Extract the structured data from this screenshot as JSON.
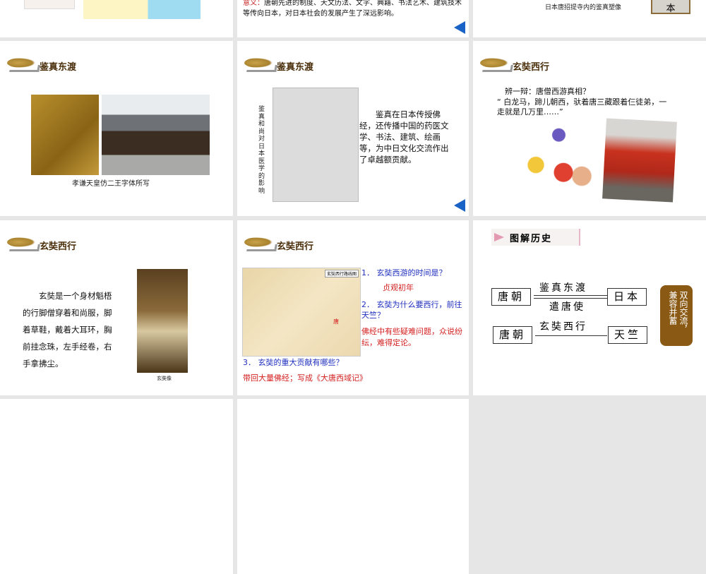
{
  "slides": {
    "s1": {},
    "s2": {
      "meaning_label": "意义：",
      "meaning_text": "唐朝先进的制度、天文历法、文字、典籍、书法艺术、建筑技术等传向日本，对日本社会的发展产生了深远影响。"
    },
    "s3": {
      "caption": "日本唐招提寺内的鉴真塑像",
      "box_text": "本"
    },
    "s4": {
      "title": "鉴真东渡",
      "caption": "孝谦天皇仿二王字体所写"
    },
    "s5": {
      "title": "鉴真东渡",
      "vertical_caption": "鉴真和尚对日本医学的影响",
      "body": "鉴真在日本传授佛经，还传播中国的药医文学、书法、建筑、绘画等，为中日文化交流作出了卓越额贡献。"
    },
    "s6": {
      "title": "玄奘西行",
      "prompt": "辨一辩：唐僧西游真相？",
      "quote": "“ 白龙马，蹄儿朝西，驮着唐三藏跟着仨徒弟，一走就是几万里……”"
    },
    "s7": {
      "title": "玄奘西行",
      "body": "玄奘是一个身材魁梧的行脚僧穿着和尚服，脚着草鞋，戴着大耳环，胸前挂念珠，左手经卷，右手拿拂尘。",
      "caption": "玄奘像"
    },
    "s8": {
      "title": "玄奘西行",
      "map_title": "玄奘西行路线图",
      "map_label_tang": "唐",
      "q1": "1． 玄奘西游的时间是？",
      "a1": "贞观初年",
      "q2": "2． 玄奘为什么要西行，前往天竺？",
      "a2": "佛经中有些疑难问题，众说纷纭，难得定论。",
      "q3": "3． 玄奘的重大贡献有哪些？",
      "a3": "带回大量佛经；写成《大唐西域记》"
    },
    "s9": {
      "title": "图解历史",
      "tang1": "唐朝",
      "japan": "日本",
      "arrow_top": "鉴真东渡",
      "arrow_bottom": "遣唐使",
      "tang2": "唐朝",
      "india": "天竺",
      "arrow2": "玄奘西行",
      "summary": "双向交流，兼容并蓄"
    }
  },
  "colors": {
    "nav_arrow": "#1a63c6",
    "question": "#1f2fbf",
    "answer": "#d42020",
    "summary_bg": "#8a5a14"
  }
}
